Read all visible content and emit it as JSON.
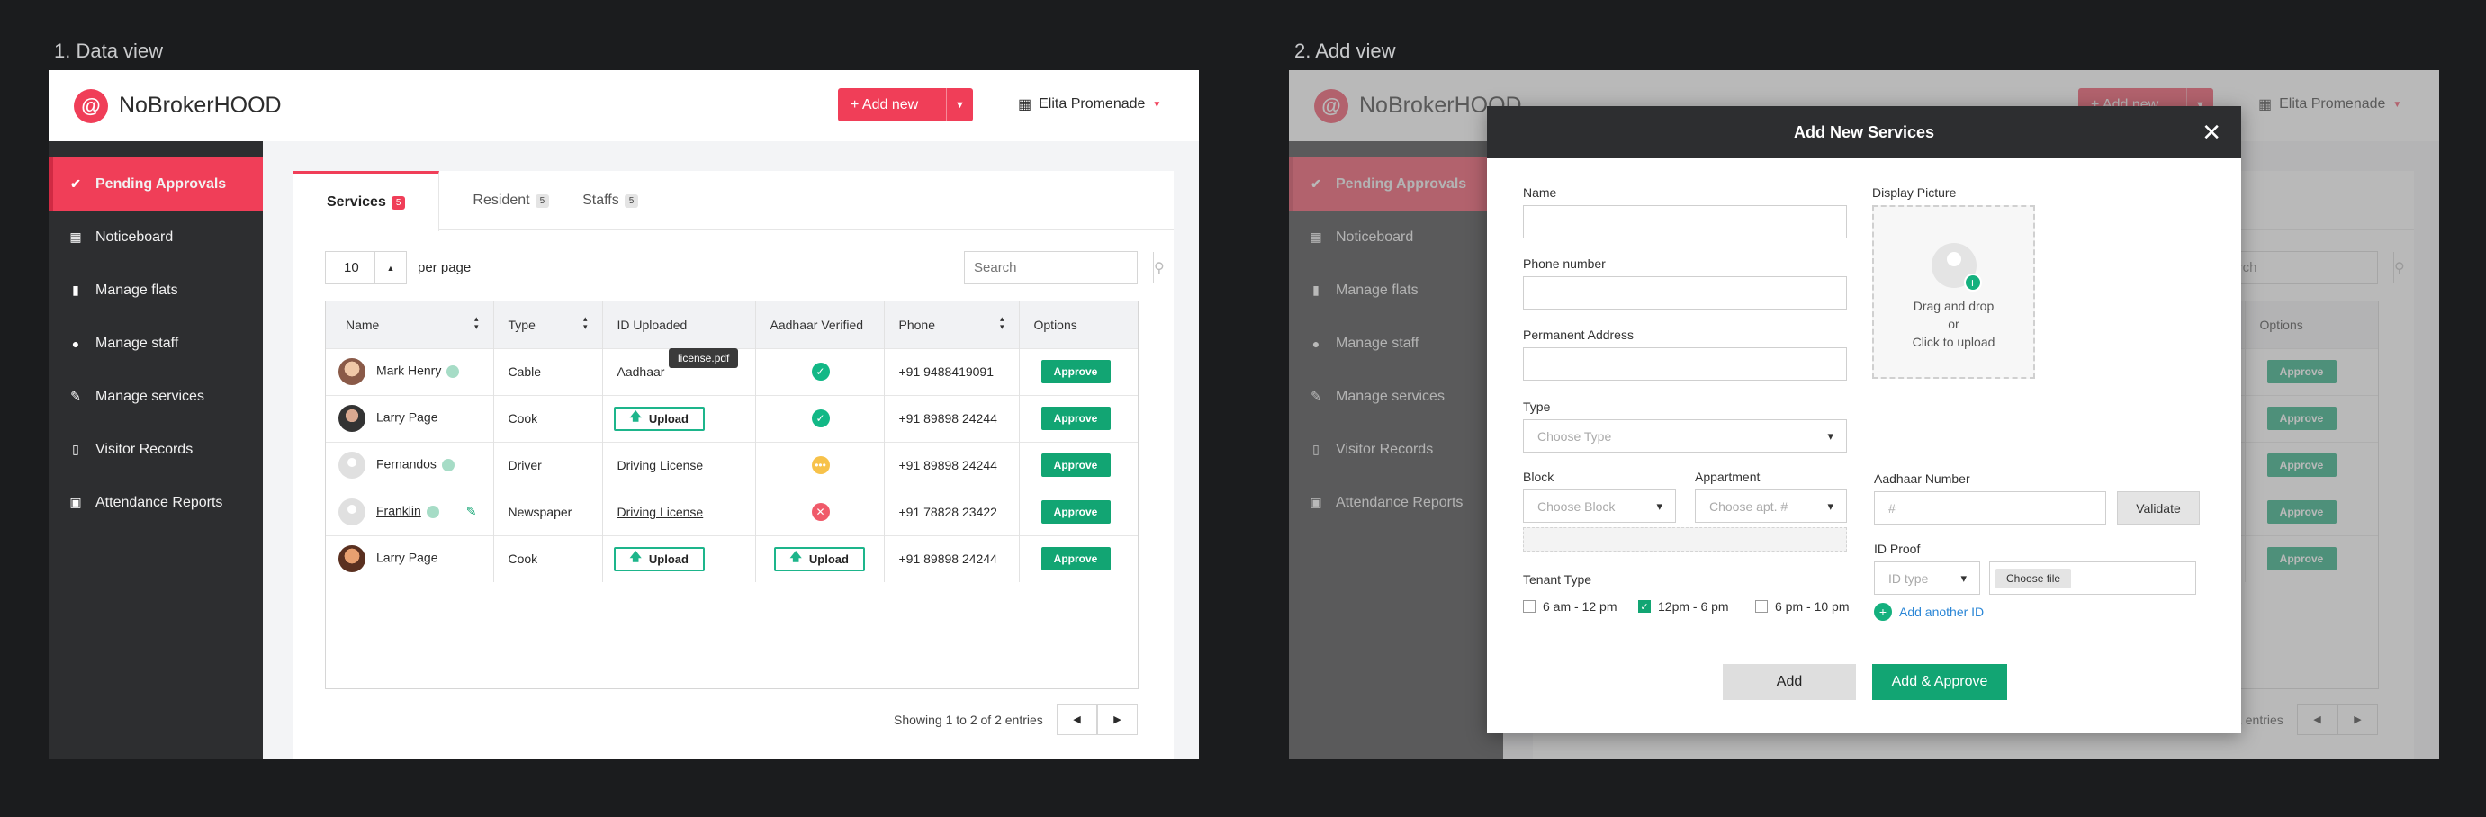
{
  "labels": {
    "view1": "1. Data view",
    "view2": "2. Add view"
  },
  "app": {
    "name": "NoBrokerHOOD",
    "logo_glyph": "@",
    "add_new": "+ Add new",
    "building": "Elita Promenade"
  },
  "sidebar": [
    {
      "label": "Pending Approvals",
      "icon": "check-circle-icon"
    },
    {
      "label": "Noticeboard",
      "icon": "noticeboard-icon"
    },
    {
      "label": "Manage flats",
      "icon": "bar-chart-icon"
    },
    {
      "label": "Manage staff",
      "icon": "person-icon"
    },
    {
      "label": "Manage services",
      "icon": "wrench-icon"
    },
    {
      "label": "Visitor Records",
      "icon": "book-icon"
    },
    {
      "label": "Attendance Reports",
      "icon": "calendar-icon"
    }
  ],
  "tabs": [
    {
      "label": "Services",
      "count": "5"
    },
    {
      "label": "Resident",
      "count": "5"
    },
    {
      "label": "Staffs",
      "count": "5"
    }
  ],
  "controls": {
    "per_page_value": "10",
    "per_page_label": "per page",
    "search_placeholder": "Search"
  },
  "table": {
    "headers": [
      "Name",
      "Type",
      "ID Uploaded",
      "Aadhaar Verified",
      "Phone",
      "Options"
    ],
    "rows": [
      {
        "name": "Mark Henry",
        "type": "Cable",
        "id": "Aadhaar",
        "phone": "+91 9488419091",
        "option": "Approve"
      },
      {
        "name": "Larry Page",
        "type": "Cook",
        "id": "Upload",
        "phone": "+91 89898 24244",
        "option": "Approve"
      },
      {
        "name": "Fernandos",
        "type": "Driver",
        "id": "Driving License",
        "phone": "+91 89898 24244",
        "option": "Approve"
      },
      {
        "name": "Franklin",
        "type": "Newspaper",
        "id": "Driving License",
        "phone": "+91 78828 23422",
        "option": "Approve"
      },
      {
        "name": "Larry Page",
        "type": "Cook",
        "id": "Upload",
        "aadhaar": "Upload",
        "phone": "+91 89898 24244",
        "option": "Approve"
      }
    ],
    "tooltip": "license.pdf",
    "showing": "Showing 1 to 2 of 2 entries"
  },
  "modal": {
    "title": "Add New Services",
    "name_label": "Name",
    "phone_label": "Phone number",
    "address_label": "Permanent Address",
    "type_label": "Type",
    "type_placeholder": "Choose Type",
    "block_label": "Block",
    "block_placeholder": "Choose Block",
    "apt_label": "Appartment",
    "apt_placeholder": "Choose apt. #",
    "tenant_label": "Tenant Type",
    "tenant_options": [
      "6 am - 12 pm",
      "12pm - 6 pm",
      "6 pm - 10 pm"
    ],
    "display_label": "Display Picture",
    "drop_text": [
      "Drag and drop",
      "or",
      "Click to upload"
    ],
    "aadhaar_label": "Aadhaar Number",
    "aadhaar_placeholder": "#",
    "validate": "Validate",
    "idproof_label": "ID Proof",
    "idtype_placeholder": "ID type",
    "choose_file": "Choose file",
    "add_another": "Add another ID",
    "btn_add": "Add",
    "btn_add_approve": "Add & Approve"
  }
}
